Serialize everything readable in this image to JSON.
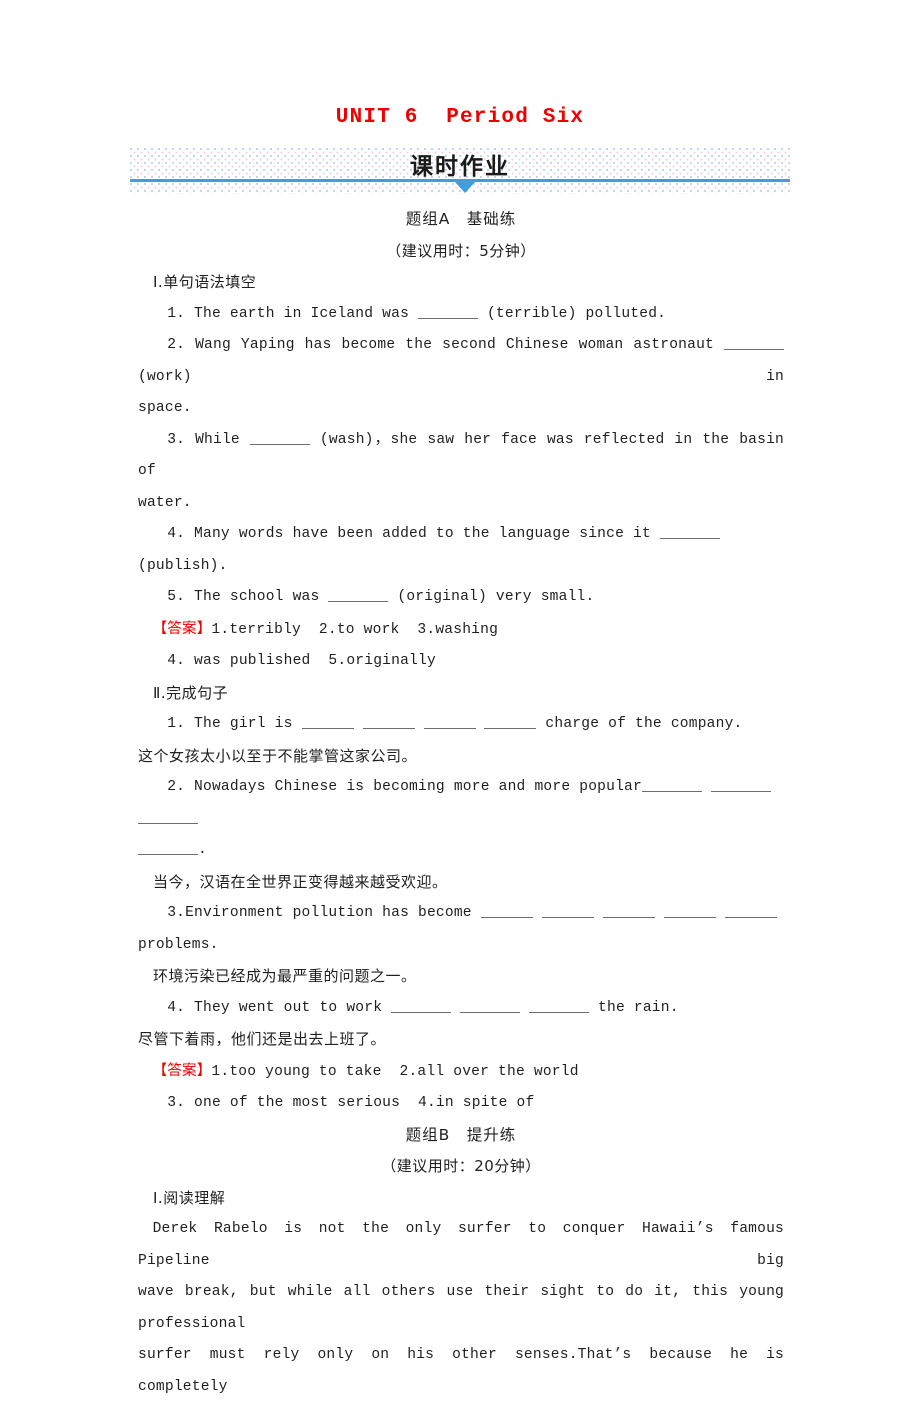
{
  "document": {
    "unit_title": "UNIT 6  Period Six",
    "banner_label": "课时作业"
  },
  "group_a": {
    "heading": "题组A　基础练",
    "time_note": "（建议用时：5分钟）",
    "section1": {
      "heading": "Ⅰ.单句语法填空",
      "q1": "1. The earth in Iceland was ",
      "q1_tail": " (terrible) polluted.",
      "q2": "2. Wang Yaping has become the second Chinese woman astronaut ",
      "q2_tail": " (work) in",
      "q2_cont": "space.",
      "q3": "3. While ",
      "q3_tail": " (wash)，she saw her face was reflected in the basin of",
      "q3_cont": "water.",
      "q4": "4. Many words have been added to the language since it ",
      "q4_tail": " (publish).",
      "q5": "5. The school was ",
      "q5_tail": " (original) very small.",
      "answer_tag": "【答案】",
      "answer_line1": "1.terribly  2.to work  3.washing",
      "answer_line2": "4. was published  5.originally"
    },
    "section2": {
      "heading": "Ⅱ.完成句子",
      "q1_lead": "1. The girl is ",
      "q1_tail": " charge of the company.",
      "q1_cn": "这个女孩太小以至于不能掌管这家公司。",
      "q2_lead": "2. Nowadays Chinese is becoming more and more popular",
      "q2_cont_tail": ".",
      "q2_cn": "当今，汉语在全世界正变得越来越受欢迎。",
      "q3_lead": "3.Environment pollution has become ",
      "q3_cont": "problems.",
      "q3_cn": "环境污染已经成为最严重的问题之一。",
      "q4_lead": "4. They went out to work ",
      "q4_tail": " the rain.",
      "q4_cn": "尽管下着雨，他们还是出去上班了。",
      "answer_tag": "【答案】",
      "answer_line1": "1.too young to take  2.all over the world",
      "answer_line2": "3. one of the most serious  4.in spite of"
    }
  },
  "group_b": {
    "heading": "题组B　提升练",
    "time_note": "（建议用时：20分钟）",
    "section1": {
      "heading": "Ⅰ.阅读理解",
      "passage_line1": "Derek Rabelo is not the only surfer to conquer Hawaii’s famous Pipeline big",
      "passage_line2": "wave break, but while all others use their sight to do it, this young professional",
      "passage_line3": "surfer must rely only on his other senses.That’s because he is completely"
    }
  },
  "colors": {
    "accent_red": "#ee0000",
    "accent_blue": "#3f9ede",
    "body_text": "#1f1f1f"
  }
}
